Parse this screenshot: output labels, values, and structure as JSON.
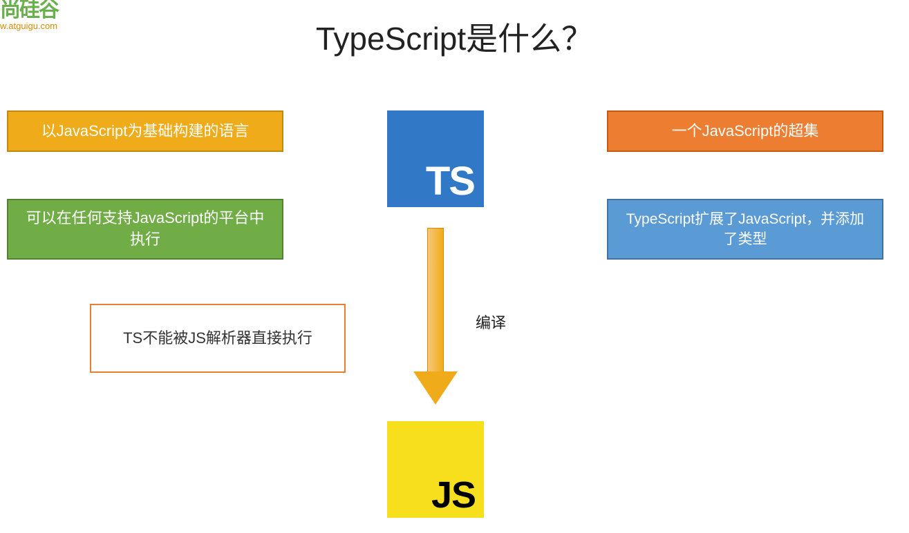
{
  "watermark": {
    "top": "尚硅谷",
    "url": "w.atguigu.com"
  },
  "title": "TypeScript是什么？",
  "boxes": {
    "yellow": "以JavaScript为基础构建的语言",
    "green": "可以在任何支持JavaScript的平台中执行",
    "orangeOutline": "TS不能被JS解析器直接执行",
    "orange": "一个JavaScript的超集",
    "blue": "TypeScript扩展了JavaScript，并添加了类型"
  },
  "logos": {
    "ts": "TS",
    "js": "JS"
  },
  "arrowLabel": "编译"
}
